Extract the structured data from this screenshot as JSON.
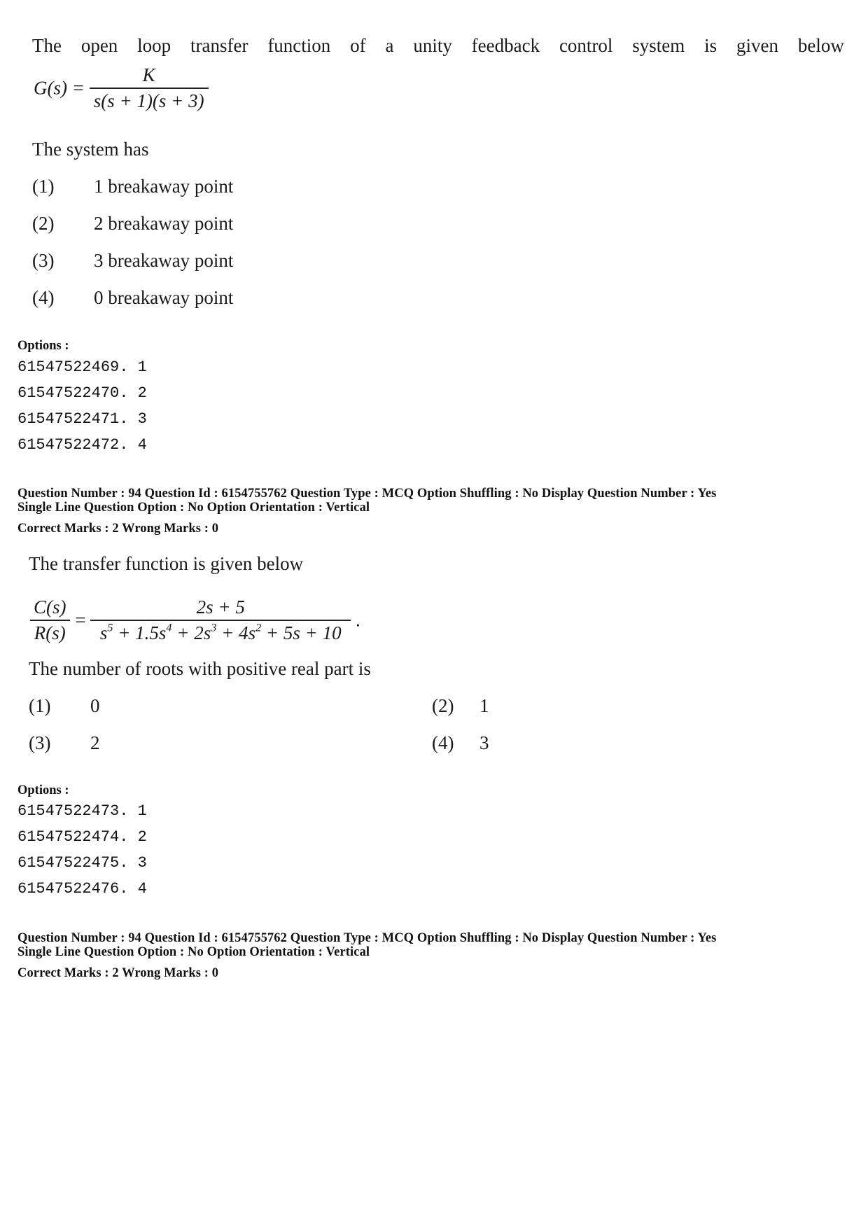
{
  "question_1": {
    "stem_words": [
      "The",
      "open",
      "loop",
      "transfer",
      "function",
      "of",
      "a",
      "unity",
      "feedback",
      "control",
      "system",
      "is",
      "given",
      "below"
    ],
    "equation": {
      "lhs": "G(s) =",
      "numerator": "K",
      "denominator": "s(s + 1)(s + 3)"
    },
    "prompt": "The system has",
    "choices": [
      {
        "label": "(1)",
        "text": "1 breakaway point"
      },
      {
        "label": "(2)",
        "text": "2 breakaway point"
      },
      {
        "label": "(3)",
        "text": "3 breakaway point"
      },
      {
        "label": "(4)",
        "text": "0 breakaway point"
      }
    ],
    "options_heading": "Options :",
    "option_ids": [
      "61547522469. 1",
      "61547522470. 2",
      "61547522471. 3",
      "61547522472. 4"
    ]
  },
  "metadata_1": {
    "line1": "Question Number : 94  Question Id : 6154755762  Question Type : MCQ  Option Shuffling : No  Display Question Number : Yes",
    "line2": "Single Line Question Option : No  Option Orientation : Vertical",
    "line3": "Correct Marks : 2  Wrong Marks : 0"
  },
  "question_2": {
    "stem": "The transfer function is given below",
    "equation": {
      "lhs_numerator": "C(s)",
      "lhs_denominator": "R(s)",
      "equals": "=",
      "numerator": "2s + 5",
      "denominator_terms": [
        {
          "base": "s",
          "exp": "5"
        },
        {
          "base": " + 1.5s",
          "exp": "4"
        },
        {
          "base": " + 2s",
          "exp": "3"
        },
        {
          "base": " + 4s",
          "exp": "2"
        },
        {
          "base": " + 5s + 10",
          "exp": ""
        }
      ],
      "trailing": "."
    },
    "prompt": "The number of  roots with positive real part is",
    "choices": [
      {
        "label": "(1)",
        "text": "0"
      },
      {
        "label": "(2)",
        "text": "1"
      },
      {
        "label": "(3)",
        "text": "2"
      },
      {
        "label": "(4)",
        "text": "3"
      }
    ],
    "options_heading": "Options :",
    "option_ids": [
      "61547522473. 1",
      "61547522474. 2",
      "61547522475. 3",
      "61547522476. 4"
    ]
  },
  "metadata_2": {
    "line1": "Question Number : 94  Question Id : 6154755762  Question Type : MCQ  Option Shuffling : No  Display Question Number : Yes",
    "line2": "Single Line Question Option : No  Option Orientation : Vertical",
    "line3": "Correct Marks : 2  Wrong Marks : 0"
  }
}
